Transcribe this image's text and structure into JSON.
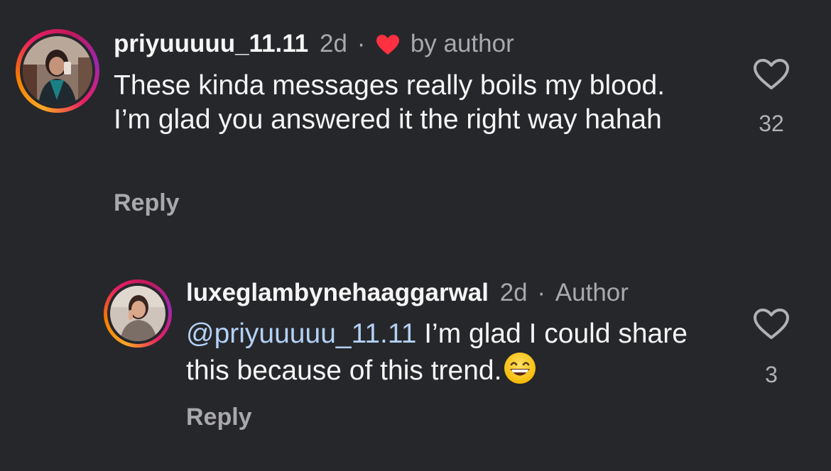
{
  "comments": [
    {
      "username": "priyuuuuu_11.11",
      "time": "2d",
      "dot": "·",
      "badge": "by author",
      "text": "These kinda messages really boils my blood. I’m glad you answered it the right way hahah",
      "reply_label": "Reply",
      "likes": "32",
      "avatar_icon": "profile-photo"
    },
    {
      "username": "luxeglambynehaaggarwal",
      "time": "2d",
      "dot": "·",
      "role": "Author",
      "mention": "@priyuuuuu_11.11",
      "text": " I’m glad I could share this because of this trend.",
      "emoji": "grinning-face-emoji",
      "reply_label": "Reply",
      "likes": "3",
      "avatar_icon": "profile-photo"
    }
  ],
  "colors": {
    "background": "#26272b",
    "text": "#f5f5f5",
    "secondary": "#a8a8ad",
    "mention": "#b3d1f5",
    "heart": "#ff3040"
  }
}
